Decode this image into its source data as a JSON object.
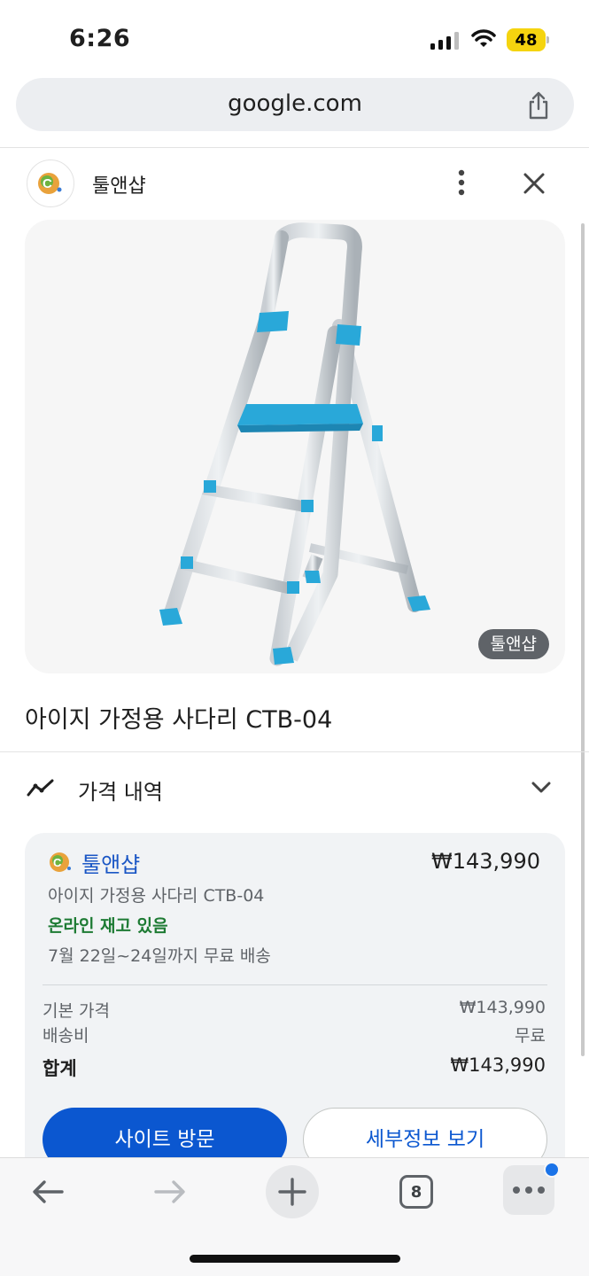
{
  "status_bar": {
    "time": "6:26",
    "battery": "48"
  },
  "browser": {
    "url": "google.com"
  },
  "store": {
    "name": "툴앤샵"
  },
  "product": {
    "image_badge": "툴앤샵",
    "title": "아이지 가정용 사다리 CTB-04"
  },
  "price_history": {
    "label": "가격 내역"
  },
  "offer": {
    "store": "툴앤샵",
    "price": "₩143,990",
    "product_name": "아이지 가정용 사다리 CTB-04",
    "stock": "온라인 재고 있음",
    "delivery": "7월 22일~24일까지 무료 배송",
    "base_price_label": "기본 가격",
    "base_price_value": "₩143,990",
    "shipping_label": "배송비",
    "shipping_value": "무료",
    "total_label": "합계",
    "total_value": "₩143,990",
    "visit_button": "사이트 방문",
    "details_button": "세부정보 보기"
  },
  "toolbar": {
    "tab_count": "8"
  },
  "colors": {
    "accent": "#0b57d0",
    "stock_green": "#1e7b34",
    "ladder_blue": "#29a8d9"
  }
}
